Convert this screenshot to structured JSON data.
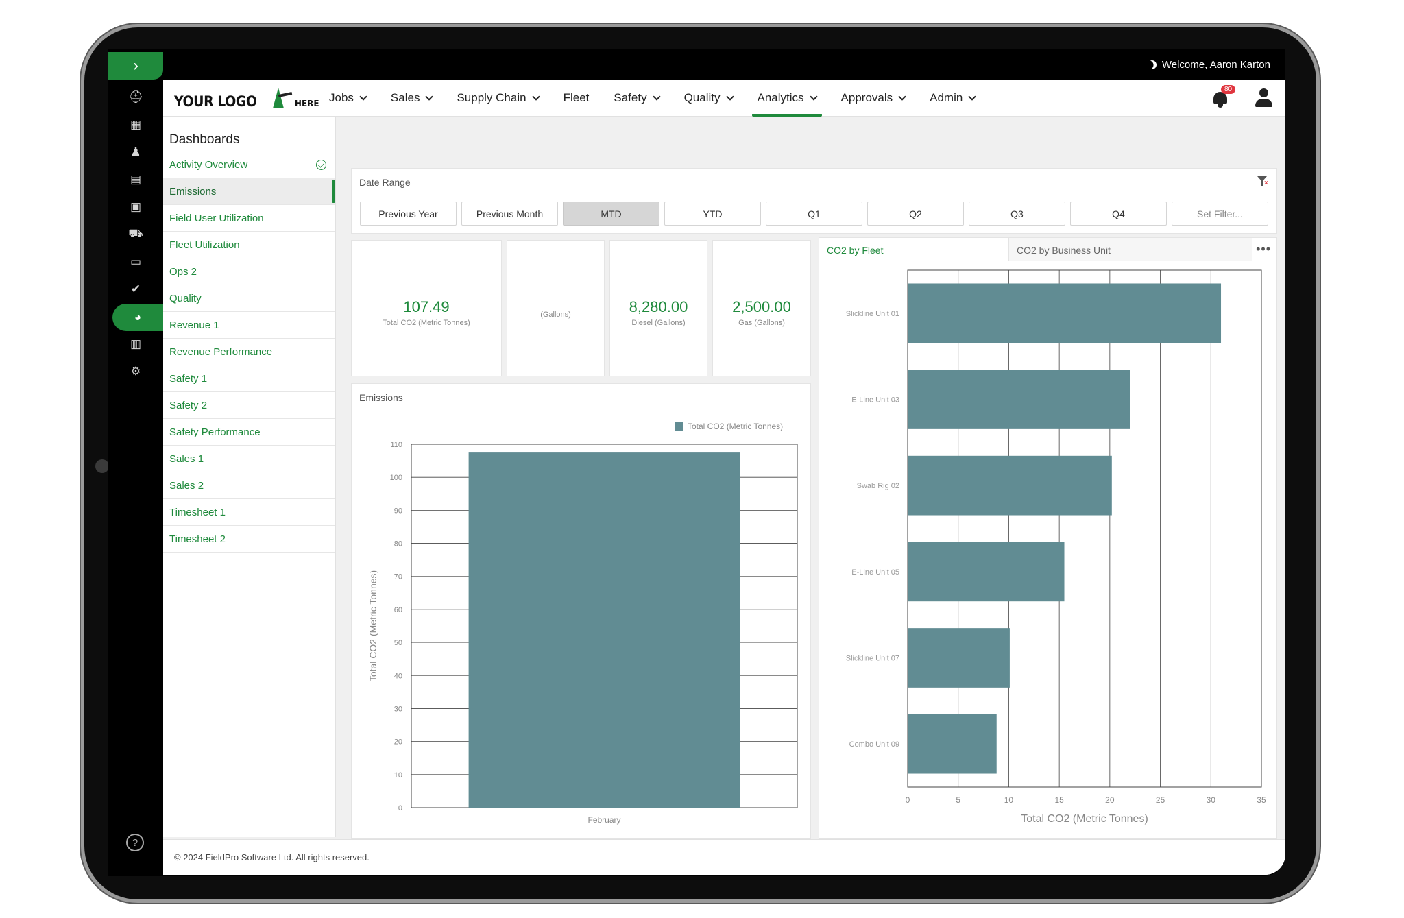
{
  "topbar": {
    "welcome": "Welcome, Aaron Karton"
  },
  "logo": {
    "main": "YOUR LOGO",
    "sub": "HERE"
  },
  "nav": {
    "items": [
      {
        "label": "Jobs",
        "dropdown": true
      },
      {
        "label": "Sales",
        "dropdown": true
      },
      {
        "label": "Supply Chain",
        "dropdown": true
      },
      {
        "label": "Fleet",
        "dropdown": false
      },
      {
        "label": "Safety",
        "dropdown": true
      },
      {
        "label": "Quality",
        "dropdown": true
      },
      {
        "label": "Analytics",
        "dropdown": true
      },
      {
        "label": "Approvals",
        "dropdown": true
      },
      {
        "label": "Admin",
        "dropdown": true
      }
    ],
    "active": "Analytics",
    "notification_count": "80"
  },
  "rail": {
    "icons": [
      "helmet-icon",
      "calendar-icon",
      "worker-icon",
      "document-icon",
      "toolbox-icon",
      "truck-icon",
      "ticket-icon",
      "shield-check-icon",
      "pie-chart-icon",
      "calendar-check-icon",
      "user-settings-icon"
    ],
    "active": "pie-chart-icon",
    "help": "?"
  },
  "sidebar": {
    "title": "Dashboards",
    "items": [
      {
        "label": "Activity Overview",
        "checked": true
      },
      {
        "label": "Emissions",
        "active": true
      },
      {
        "label": "Field User Utilization"
      },
      {
        "label": "Fleet Utilization"
      },
      {
        "label": "Ops 2"
      },
      {
        "label": "Quality"
      },
      {
        "label": "Revenue 1"
      },
      {
        "label": "Revenue Performance"
      },
      {
        "label": "Safety 1"
      },
      {
        "label": "Safety 2"
      },
      {
        "label": "Safety Performance"
      },
      {
        "label": "Sales 1"
      },
      {
        "label": "Sales 2"
      },
      {
        "label": "Timesheet 1"
      },
      {
        "label": "Timesheet 2"
      }
    ]
  },
  "date_range": {
    "title": "Date Range",
    "buttons": [
      "Previous Year",
      "Previous Month",
      "MTD",
      "YTD",
      "Q1",
      "Q2",
      "Q3",
      "Q4",
      "Set Filter..."
    ],
    "active": "MTD"
  },
  "kpis": [
    {
      "value": "107.49",
      "label": "Total CO2 (Metric Tonnes)"
    },
    {
      "value": "",
      "label": "(Gallons)"
    },
    {
      "value": "8,280.00",
      "label": "Diesel (Gallons)"
    },
    {
      "value": "2,500.00",
      "label": "Gas (Gallons)"
    }
  ],
  "emissions_panel": {
    "title": "Emissions"
  },
  "fleet_panel": {
    "tabs": [
      "CO2 by Fleet",
      "CO2 by Business Unit"
    ],
    "active_tab": "CO2 by Fleet",
    "more": "•••"
  },
  "chart_data": [
    {
      "type": "bar",
      "categories": [
        "February"
      ],
      "series": [
        {
          "name": "Total CO2 (Metric Tonnes)",
          "values": [
            107.49
          ]
        }
      ],
      "ylabel": "Total CO2 (Metric Tonnes)",
      "ylim": [
        0,
        110
      ],
      "yticks": [
        0,
        10,
        20,
        30,
        40,
        50,
        60,
        70,
        80,
        90,
        100,
        110
      ],
      "legend": "top-right",
      "grid": true,
      "color": "#618c93"
    },
    {
      "type": "bar",
      "orientation": "horizontal",
      "categories": [
        "Slickline Unit 01",
        "E-Line Unit 03",
        "Swab Rig 02",
        "E-Line Unit 05",
        "Slickline Unit 07",
        "Combo Unit 09"
      ],
      "values": [
        31,
        22,
        20.2,
        15.5,
        10.1,
        8.8
      ],
      "xlabel": "Total CO2 (Metric Tonnes)",
      "xlim": [
        0,
        35
      ],
      "xticks": [
        0,
        5,
        10,
        15,
        20,
        25,
        30,
        35
      ],
      "grid": true,
      "color": "#618c93"
    }
  ],
  "footer": {
    "copyright": "© 2024 FieldPro Software Ltd. All rights reserved."
  }
}
